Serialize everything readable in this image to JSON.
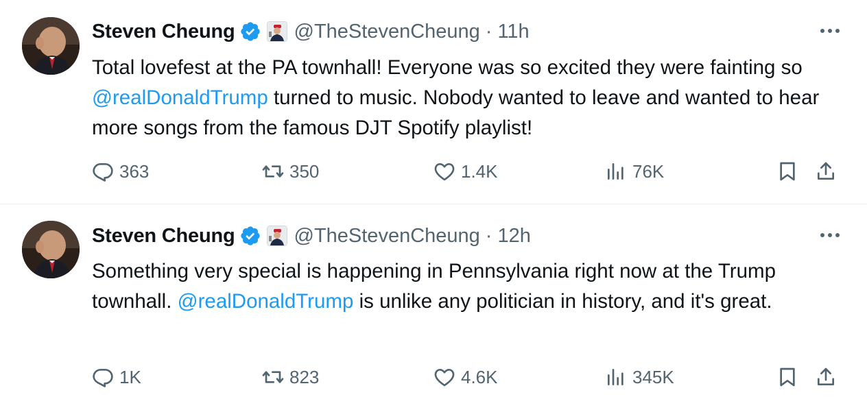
{
  "tweets": [
    {
      "author": {
        "name": "Steven Cheung",
        "handle": "@TheStevenCheung",
        "verified_icon": "verified-badge-icon",
        "affiliation_icon": "affiliate-badge-icon"
      },
      "separator": "·",
      "time": "11h",
      "text_parts": {
        "before": "Total lovefest at the PA townhall! Everyone was so excited they were fainting so ",
        "mention": "@realDonaldTrump",
        "after": " turned to music. Nobody wanted to leave and wanted to hear more songs from the famous DJT Spotify playlist!"
      },
      "stats": {
        "replies": "363",
        "reposts": "350",
        "likes": "1.4K",
        "views": "76K"
      }
    },
    {
      "author": {
        "name": "Steven Cheung",
        "handle": "@TheStevenCheung",
        "verified_icon": "verified-badge-icon",
        "affiliation_icon": "affiliate-badge-icon"
      },
      "separator": "·",
      "time": "12h",
      "text_parts": {
        "before": "Something very special is happening in Pennsylvania right now at the Trump townhall. ",
        "mention": "@realDonaldTrump",
        "after": " is unlike any politician in history, and it's great."
      },
      "stats": {
        "replies": "1K",
        "reposts": "823",
        "likes": "4.6K",
        "views": "345K"
      }
    }
  ],
  "colors": {
    "text": "#0f1419",
    "secondary": "#536471",
    "link": "#1d9bf0",
    "verified": "#1d9bf0",
    "divider": "#eff3f4"
  }
}
